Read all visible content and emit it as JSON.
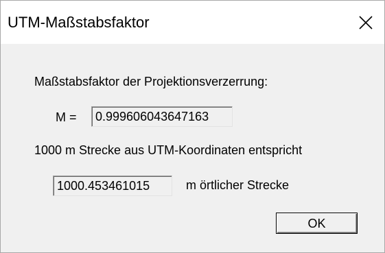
{
  "window": {
    "title": "UTM-Maßstabsfaktor",
    "close_icon": "close-icon"
  },
  "dialog": {
    "heading": "Maßstabsfaktor der Projektionsverzerrung:",
    "m_label": "M =",
    "m_value": "0.999606043647163",
    "sentence": "1000 m Strecke aus UTM-Koordinaten entspricht",
    "distance_value": "1000.453461015",
    "distance_suffix": "m örtlicher Strecke",
    "ok_label": "OK"
  }
}
